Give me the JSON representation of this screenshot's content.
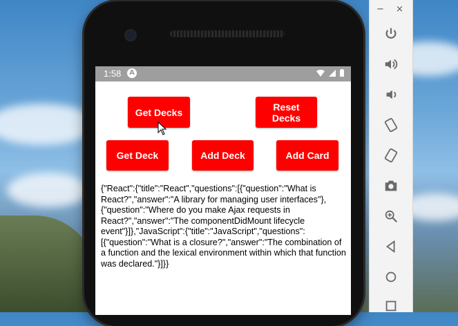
{
  "status_bar": {
    "time": "1:58",
    "app_badge": "A",
    "icons": "▾◢▮"
  },
  "buttons": {
    "get_decks": "Get Decks",
    "reset_decks": "Reset Decks",
    "get_deck": "Get Deck",
    "add_deck": "Add Deck",
    "add_card": "Add Card"
  },
  "output_text": "{\"React\":{\"title\":\"React\",\"questions\":[{\"question\":\"What is React?\",\"answer\":\"A library for managing user interfaces\"},{\"question\":\"Where do you make Ajax requests in React?\",\"answer\":\"The componentDidMount lifecycle event\"}]},\"JavaScript\":{\"title\":\"JavaScript\",\"questions\":[{\"question\":\"What is a closure?\",\"answer\":\"The combination of a function and the lexical environment within which that function was declared.\"}]}}",
  "emulator_panel": {
    "minimize": "−",
    "close": "×",
    "buttons": [
      "power-icon",
      "volume-up-icon",
      "volume-down-icon",
      "rotate-left-icon",
      "rotate-right-icon",
      "camera-icon",
      "zoom-icon",
      "back-icon",
      "home-icon",
      "overview-icon"
    ]
  },
  "colors": {
    "button_red": "#ff0000",
    "status_bar": "#9e9e9e"
  }
}
